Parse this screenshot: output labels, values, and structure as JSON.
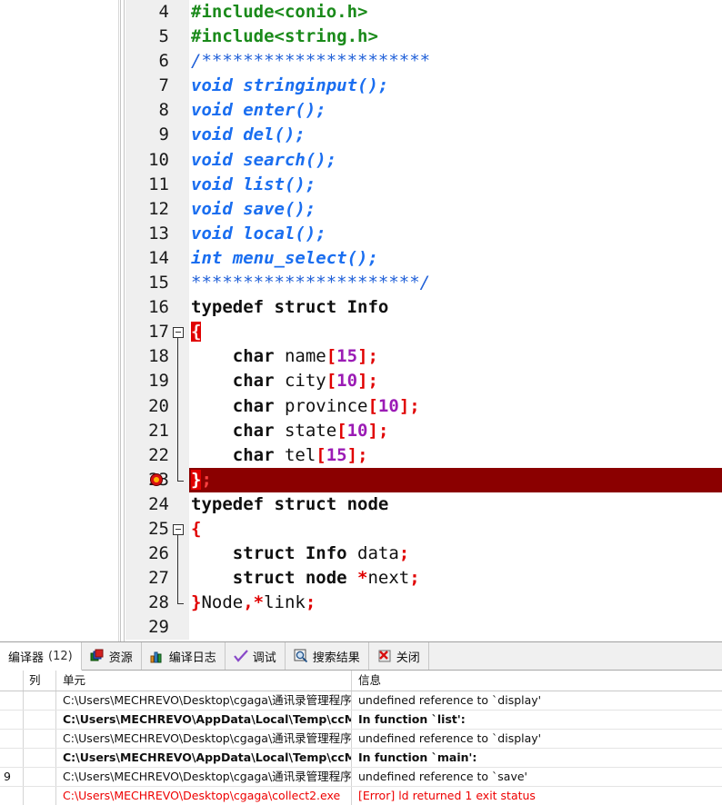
{
  "editor": {
    "first_visible_line": 4,
    "lines": [
      {
        "num": 4,
        "tokens": [
          {
            "t": "#include<conio.h>",
            "c": "t-pre"
          }
        ]
      },
      {
        "num": 5,
        "tokens": [
          {
            "t": "#include<string.h>",
            "c": "t-pre"
          }
        ]
      },
      {
        "num": 6,
        "tokens": [
          {
            "t": "/**********************",
            "c": "t-com"
          }
        ]
      },
      {
        "num": 7,
        "tokens": [
          {
            "t": "void stringinput();",
            "c": "t-kwt"
          }
        ]
      },
      {
        "num": 8,
        "tokens": [
          {
            "t": "void enter();",
            "c": "t-kwt"
          }
        ]
      },
      {
        "num": 9,
        "tokens": [
          {
            "t": "void del();",
            "c": "t-kwt"
          }
        ]
      },
      {
        "num": 10,
        "tokens": [
          {
            "t": "void search();",
            "c": "t-kwt"
          }
        ]
      },
      {
        "num": 11,
        "tokens": [
          {
            "t": "void list();",
            "c": "t-kwt"
          }
        ]
      },
      {
        "num": 12,
        "tokens": [
          {
            "t": "void save();",
            "c": "t-kwt"
          }
        ]
      },
      {
        "num": 13,
        "tokens": [
          {
            "t": "void local();",
            "c": "t-kwt"
          }
        ]
      },
      {
        "num": 14,
        "tokens": [
          {
            "t": "int menu_select();",
            "c": "t-kwt"
          }
        ]
      },
      {
        "num": 15,
        "tokens": [
          {
            "t": "**********************/",
            "c": "t-com"
          }
        ]
      },
      {
        "num": 16,
        "tokens": [
          {
            "t": "typedef struct Info",
            "c": "t-kw"
          }
        ]
      },
      {
        "num": 17,
        "fold": "start",
        "tokens": [
          {
            "t": "{",
            "c": "t-brace-hl"
          }
        ]
      },
      {
        "num": 18,
        "fold": "mid",
        "tokens": [
          {
            "t": "    char ",
            "c": "t-kw"
          },
          {
            "t": "name",
            "c": "t-id"
          },
          {
            "t": "[",
            "c": "t-punc"
          },
          {
            "t": "15",
            "c": "t-num"
          },
          {
            "t": "];",
            "c": "t-punc"
          }
        ]
      },
      {
        "num": 19,
        "fold": "mid",
        "tokens": [
          {
            "t": "    char ",
            "c": "t-kw"
          },
          {
            "t": "city",
            "c": "t-id"
          },
          {
            "t": "[",
            "c": "t-punc"
          },
          {
            "t": "10",
            "c": "t-num"
          },
          {
            "t": "];",
            "c": "t-punc"
          }
        ]
      },
      {
        "num": 20,
        "fold": "mid",
        "tokens": [
          {
            "t": "    char ",
            "c": "t-kw"
          },
          {
            "t": "province",
            "c": "t-id"
          },
          {
            "t": "[",
            "c": "t-punc"
          },
          {
            "t": "10",
            "c": "t-num"
          },
          {
            "t": "];",
            "c": "t-punc"
          }
        ]
      },
      {
        "num": 21,
        "fold": "mid",
        "tokens": [
          {
            "t": "    char ",
            "c": "t-kw"
          },
          {
            "t": "state",
            "c": "t-id"
          },
          {
            "t": "[",
            "c": "t-punc"
          },
          {
            "t": "10",
            "c": "t-num"
          },
          {
            "t": "];",
            "c": "t-punc"
          }
        ]
      },
      {
        "num": 22,
        "fold": "mid",
        "tokens": [
          {
            "t": "    char ",
            "c": "t-kw"
          },
          {
            "t": "tel",
            "c": "t-id"
          },
          {
            "t": "[",
            "c": "t-punc"
          },
          {
            "t": "15",
            "c": "t-num"
          },
          {
            "t": "];",
            "c": "t-punc"
          }
        ]
      },
      {
        "num": 23,
        "fold": "end",
        "error": true,
        "tokens": [
          {
            "t": "}",
            "c": "t-brace-hl-dark"
          },
          {
            "t": ";",
            "c": "t-punc-on-err"
          }
        ]
      },
      {
        "num": 24,
        "tokens": [
          {
            "t": "typedef struct node",
            "c": "t-kw"
          }
        ]
      },
      {
        "num": 25,
        "fold": "start",
        "tokens": [
          {
            "t": "{",
            "c": "t-punc"
          }
        ]
      },
      {
        "num": 26,
        "fold": "mid",
        "tokens": [
          {
            "t": "    struct Info ",
            "c": "t-kw"
          },
          {
            "t": "data",
            "c": "t-id"
          },
          {
            "t": ";",
            "c": "t-punc"
          }
        ]
      },
      {
        "num": 27,
        "fold": "mid",
        "tokens": [
          {
            "t": "    struct node ",
            "c": "t-kw"
          },
          {
            "t": "*",
            "c": "t-punc"
          },
          {
            "t": "next",
            "c": "t-id"
          },
          {
            "t": ";",
            "c": "t-punc"
          }
        ]
      },
      {
        "num": 28,
        "fold": "end",
        "tokens": [
          {
            "t": "}",
            "c": "t-punc"
          },
          {
            "t": "Node",
            "c": "t-id"
          },
          {
            "t": ",*",
            "c": "t-punc"
          },
          {
            "t": "link",
            "c": "t-id"
          },
          {
            "t": ";",
            "c": "t-punc"
          }
        ]
      },
      {
        "num": 29,
        "tokens": [
          {
            "t": "",
            "c": "t-id"
          }
        ]
      }
    ]
  },
  "bottom_panel": {
    "tabs": [
      {
        "label": "编译器",
        "count": "(12)",
        "icon": "compiler-icon",
        "active": true,
        "has_icon": false
      },
      {
        "label": "资源",
        "count": "",
        "icon": "resources-icon",
        "active": false,
        "has_icon": true
      },
      {
        "label": "编译日志",
        "count": "",
        "icon": "compile-log-icon",
        "active": false,
        "has_icon": true
      },
      {
        "label": "调试",
        "count": "",
        "icon": "debug-check-icon",
        "active": false,
        "has_icon": true
      },
      {
        "label": "搜索结果",
        "count": "",
        "icon": "search-results-icon",
        "active": false,
        "has_icon": true
      },
      {
        "label": "关闭",
        "count": "",
        "icon": "close-icon",
        "active": false,
        "has_icon": true
      }
    ],
    "table": {
      "columns": [
        "",
        "列",
        "单元",
        "信息"
      ],
      "rows": [
        {
          "line": "",
          "col": "",
          "unit": "C:\\Users\\MECHREVO\\Desktop\\cgaga\\通讯录管理程序.c",
          "msg": "undefined reference to `display'",
          "bold": false,
          "error": false
        },
        {
          "line": "",
          "col": "",
          "unit": "C:\\Users\\MECHREVO\\AppData\\Local\\Temp\\ccMAUezl.o",
          "msg": "In function `list':",
          "bold": true,
          "error": false
        },
        {
          "line": "",
          "col": "",
          "unit": "C:\\Users\\MECHREVO\\Desktop\\cgaga\\通讯录管理程序.c",
          "msg": "undefined reference to `display'",
          "bold": false,
          "error": false
        },
        {
          "line": "",
          "col": "",
          "unit": "C:\\Users\\MECHREVO\\AppData\\Local\\Temp\\ccMAUezl.o",
          "msg": "In function `main':",
          "bold": true,
          "error": false
        },
        {
          "line": "9",
          "col": "",
          "unit": "C:\\Users\\MECHREVO\\Desktop\\cgaga\\通讯录管理程序.c",
          "msg": "undefined reference to `save'",
          "bold": false,
          "error": false
        },
        {
          "line": "",
          "col": "",
          "unit": "C:\\Users\\MECHREVO\\Desktop\\cgaga\\collect2.exe",
          "msg": "[Error] ld returned 1 exit status",
          "bold": false,
          "error": true
        }
      ]
    }
  },
  "colors": {
    "error_row_bg": "#8B0000",
    "brace_highlight": "#e00000",
    "gutter_bg": "#efefef",
    "error_text": "#ee0000",
    "preproc_green": "#1a8a1a",
    "comment_blue": "#2060d8",
    "type_blue": "#1a6ef0",
    "number_purple": "#9b1bb5"
  }
}
